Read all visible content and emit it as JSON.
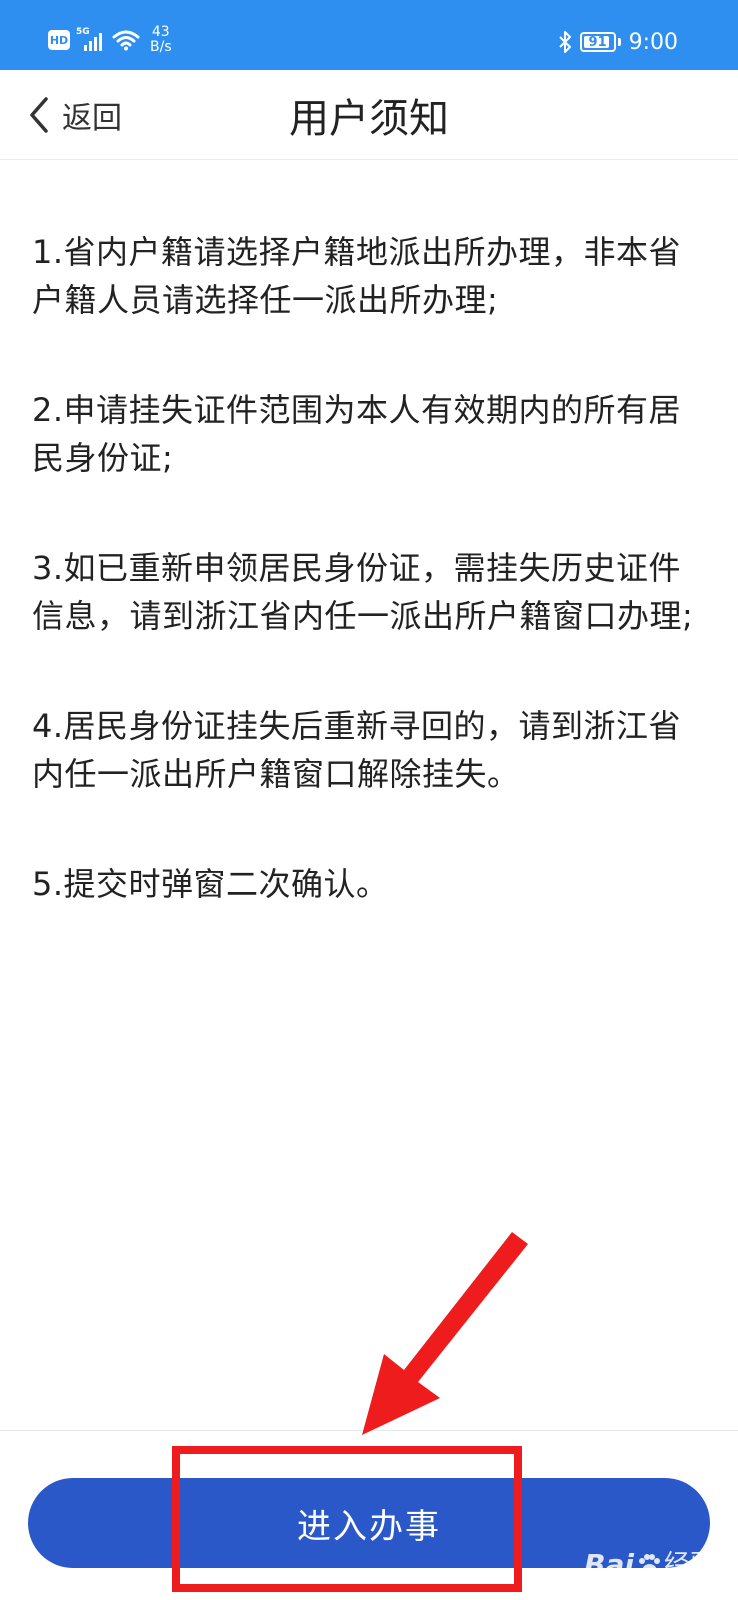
{
  "status_bar": {
    "network_badge": "HD",
    "network_type": "5G",
    "speed_value": "43",
    "speed_unit": "B/s",
    "battery_level": "91",
    "time": "9:00"
  },
  "nav": {
    "back_label": "返回",
    "title": "用户须知"
  },
  "notices": [
    "1.省内户籍请选择户籍地派出所办理，非本省户籍人员请选择任一派出所办理;",
    "2.申请挂失证件范围为本人有效期内的所有居民身份证;",
    "3.如已重新申领居民身份证，需挂失历史证件信息，请到浙江省内任一派出所户籍窗口办理;",
    "4.居民身份证挂失后重新寻回的，请到浙江省内任一派出所户籍窗口解除挂失。",
    "5.提交时弹窗二次确认。"
  ],
  "action": {
    "enter_label": "进入办事"
  },
  "watermark": {
    "logo_text": "Bai",
    "logo_suffix": "经验"
  },
  "colors": {
    "status_bar": "#2f8ff0",
    "primary_button": "#2b58c8",
    "annotation": "#ee1c1c"
  },
  "icons": {
    "back": "chevron-left-icon",
    "wifi": "wifi-icon",
    "bluetooth": "bluetooth-icon",
    "battery": "battery-icon",
    "signal": "signal-icon"
  }
}
